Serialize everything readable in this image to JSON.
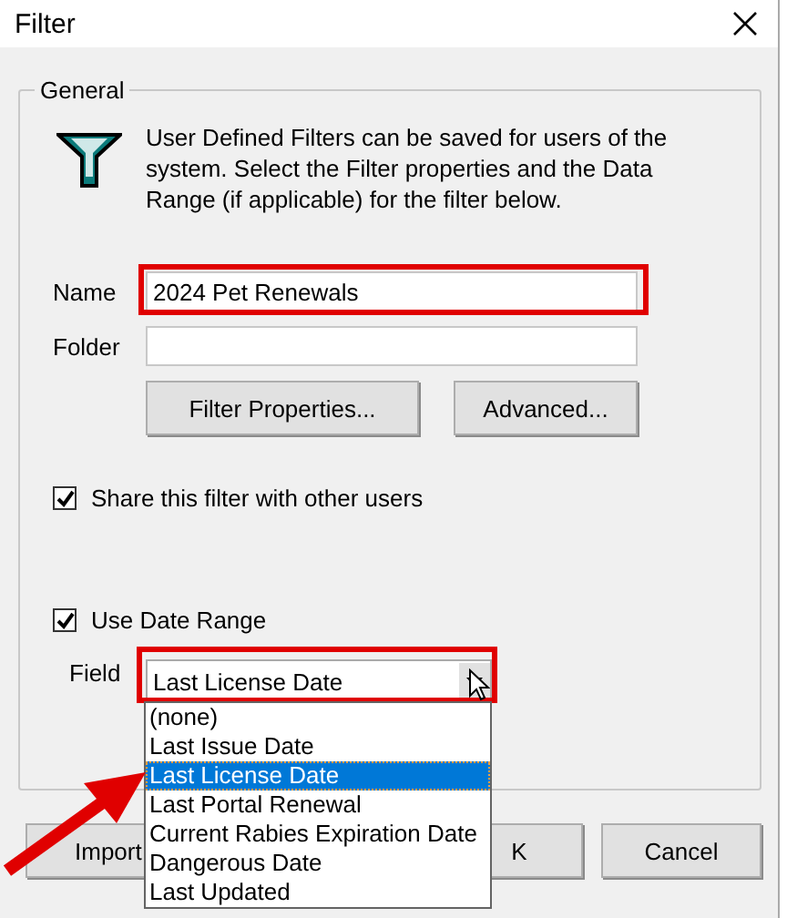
{
  "window": {
    "title": "Filter"
  },
  "group": {
    "title": "General",
    "description": "User Defined Filters can be saved for users of the system. Select the Filter properties and the Data Range (if applicable) for the filter below."
  },
  "name": {
    "label": "Name",
    "value": "2024 Pet Renewals",
    "highlighted": true
  },
  "folder": {
    "label": "Folder"
  },
  "actions": [
    "Filter Properties...",
    "Advanced..."
  ],
  "share": {
    "label": "Share this filter with other users",
    "checked": true
  },
  "date_range": {
    "label": "Use Date Range",
    "checked": true
  },
  "field": {
    "label": "Field",
    "value": "Last License Date",
    "highlighted": true,
    "expanded": true,
    "options": [
      {
        "label": "(none)",
        "selected": false,
        "pointed": false
      },
      {
        "label": "Last Issue Date",
        "selected": false,
        "pointed": false
      },
      {
        "label": "Last License Date",
        "selected": true,
        "pointed": true
      },
      {
        "label": "Last Portal Renewal",
        "selected": false,
        "pointed": false
      },
      {
        "label": "Current Rabies Expiration Date",
        "selected": false,
        "pointed": false
      },
      {
        "label": "Dangerous Date",
        "selected": false,
        "pointed": false
      },
      {
        "label": "Last Updated",
        "selected": false,
        "pointed": false
      }
    ]
  },
  "buttons": [
    {
      "kind": "import",
      "label": "Import"
    },
    {
      "kind": "ok",
      "label": "K"
    },
    {
      "kind": "cancel",
      "label": "Cancel"
    }
  ]
}
